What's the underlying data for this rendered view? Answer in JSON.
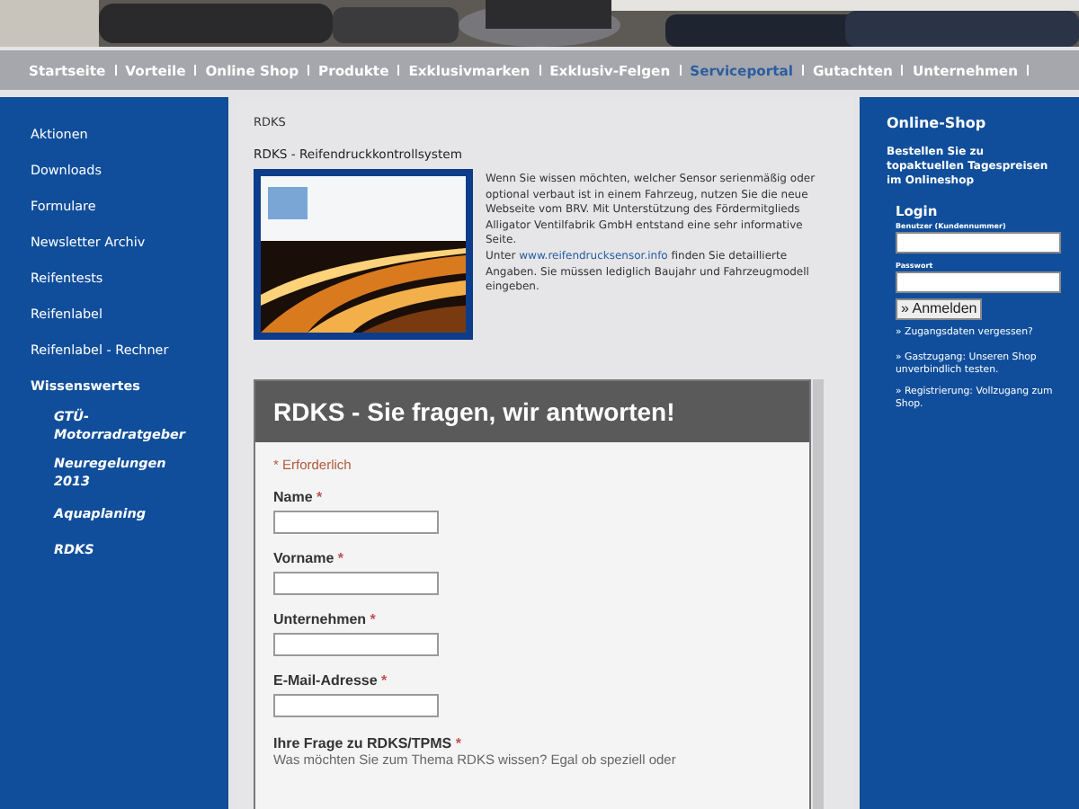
{
  "nav": [
    {
      "label": "Startseite",
      "selected": false
    },
    {
      "label": "Vorteile",
      "selected": false
    },
    {
      "label": "Online Shop",
      "selected": false
    },
    {
      "label": "Produkte",
      "selected": false
    },
    {
      "label": "Exklusivmarken",
      "selected": false
    },
    {
      "label": "Exklusiv-Felgen",
      "selected": false
    },
    {
      "label": "Serviceportal",
      "selected": true
    },
    {
      "label": "Gutachten",
      "selected": false
    },
    {
      "label": "Unternehmen",
      "selected": false
    }
  ],
  "sidebar": {
    "items": [
      {
        "label": "Aktionen"
      },
      {
        "label": "Downloads"
      },
      {
        "label": "Formulare"
      },
      {
        "label": "Newsletter Archiv"
      },
      {
        "label": "Reifentests"
      },
      {
        "label": "Reifenlabel"
      },
      {
        "label": "Reifenlabel - Rechner"
      },
      {
        "label": "Wissenswertes",
        "expanded": true,
        "children": [
          {
            "label": "GTÜ-Motorradratgeber"
          },
          {
            "label": "Neuregelungen 2013"
          },
          {
            "label": "Aquaplaning"
          },
          {
            "label": "RDKS"
          }
        ]
      }
    ]
  },
  "breadcrumb": "RDKS",
  "article": {
    "title": "RDKS - Reifendruckkontrollsystem",
    "paragraph": "Wenn Sie wissen möchten, welcher Sensor serienmäßig oder optional verbaut ist in einem Fahrzeug, nutzen Sie die neue Webseite vom BRV. Mit Unterstützung des Fördermitglieds Alligator Ventilfabrik GmbH entstand eine sehr informative Seite.",
    "link_prefix": "Unter",
    "link": "www.reifendrucksensor.info",
    "link_suffix": "finden Sie detaillierte Angaben. Sie müssen lediglich Baujahr und Fahrzeugmodell eingeben."
  },
  "form": {
    "title": "RDKS - Sie fragen, wir antworten!",
    "required_note": "* Erforderlich",
    "fields": [
      {
        "label": "Name",
        "mark": "*"
      },
      {
        "label": "Vorname",
        "mark": "*"
      },
      {
        "label": "Unternehmen",
        "mark": "*"
      },
      {
        "label": "E-Mail-Adresse",
        "mark": "*"
      }
    ],
    "question": {
      "label": "Ihre Frage zu RDKS/TPMS",
      "mark": "*",
      "help": "Was möchten Sie zum Thema RDKS wissen? Egal ob speziell oder"
    }
  },
  "shop": {
    "title": "Online-Shop",
    "text": "Bestellen Sie zu topaktuellen Tagespreisen im Onlineshop",
    "login": {
      "title": "Login",
      "user_label": "Benutzer (Kundennummer)",
      "password_label": "Passwort",
      "button": "» Anmelden"
    },
    "links": [
      "» Zugangsdaten vergessen?",
      "» Gastzugang: Unseren Shop unverbindlich testen.",
      "» Registrierung: Vollzugang zum Shop."
    ]
  }
}
